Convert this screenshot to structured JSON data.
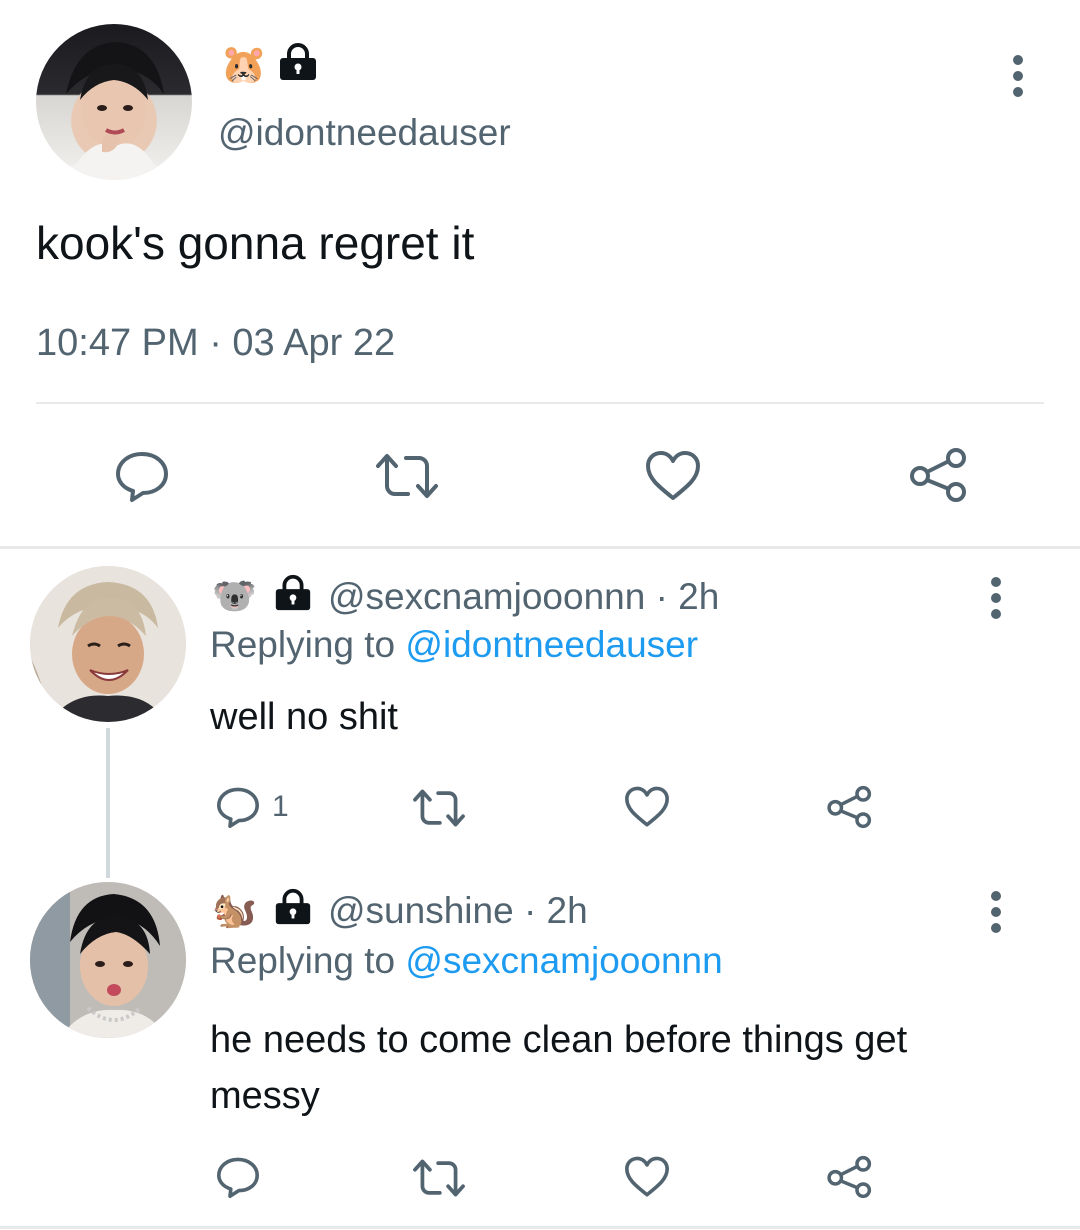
{
  "main_tweet": {
    "handle": "@idontneedauser",
    "badge_emoji": "🐹",
    "lock_icon": "lock-icon",
    "text": "kook's gonna regret it",
    "timestamp": "10:47 PM · 03 Apr 22",
    "actions": [
      "reply-icon",
      "retweet-icon",
      "like-icon",
      "share-icon"
    ]
  },
  "replies": [
    {
      "badge_emoji": "🐨",
      "handle_time": "@sexcnamjooonnn · 2h",
      "replying_prefix": "Replying to",
      "replying_to": "@idontneedauser",
      "text": "well no shit",
      "reply_count": "1"
    },
    {
      "badge_emoji": "🐿️",
      "handle_time": "@sunshine · 2h",
      "replying_prefix": "Replying to",
      "replying_to": "@sexcnamjooonnn",
      "text": "he needs to come clean before things get messy",
      "reply_count": ""
    }
  ],
  "colors": {
    "text": "#0f1419",
    "secondary": "#536471",
    "accent": "#1d9bf0",
    "divider": "#e7e9ea"
  }
}
